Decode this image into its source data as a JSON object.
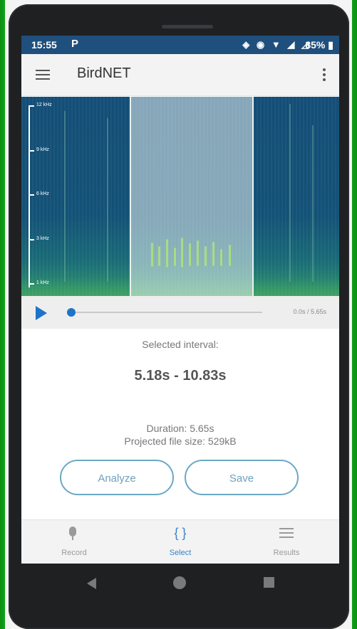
{
  "status_bar": {
    "time": "15:55",
    "carrier_glyph": "P",
    "battery": "85%",
    "icons": [
      "vibrate-icon",
      "location-icon",
      "wifi-icon",
      "signal-icon",
      "signal-empty-icon"
    ]
  },
  "app_bar": {
    "title": "BirdNET"
  },
  "spectrogram": {
    "frequency_labels": [
      "12 kHz",
      "9 kHz",
      "6 kHz",
      "3 kHz",
      "1 kHz"
    ]
  },
  "player": {
    "time_readout": "0.0s / 5.65s",
    "progress": 0.0
  },
  "selection": {
    "label": "Selected interval:",
    "interval": "5.18s - 10.83s",
    "duration": "Duration: 5.65s",
    "file_size": "Projected file size: 529kB"
  },
  "actions": {
    "analyze": "Analyze",
    "save": "Save"
  },
  "bottom_nav": {
    "items": [
      {
        "label": "Record",
        "icon": "mic-icon"
      },
      {
        "label": "Select",
        "icon": "brackets-icon"
      },
      {
        "label": "Results",
        "icon": "list-icon"
      }
    ],
    "active": "Select"
  },
  "colors": {
    "status_bar": "#1f4f7d",
    "accent": "#1e73c8",
    "button_border": "#6aa8c6"
  }
}
